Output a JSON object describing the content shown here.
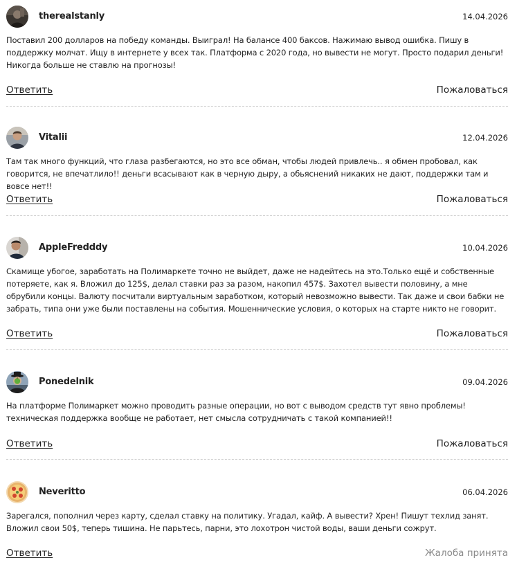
{
  "comments": [
    {
      "username": "therealstanly",
      "date": "14.04.2026",
      "avatar_icon": "avatar-dark-portrait-icon",
      "text": "Поставил 200 долларов на победу команды. Выиграл! На балансе 400 баксов. Нажимаю вывод ошибка. Пишу в поддержку молчат. Ищу в интернете у всех так. Платформа с 2020 года, но вывести не могут. Просто подарил деньги! Никогда больше не ставлю на прогнозы!",
      "reply_label": "Ответить",
      "report_label": "Пожаловаться"
    },
    {
      "username": "Vitalii",
      "date": "12.04.2026",
      "avatar_icon": "avatar-man-portrait-icon",
      "text": "Там так много функций, что глаза разбегаются, но это все обман, чтобы людей привлечь.. я обмен пробовал, как говорится, не впечатлило!! деньги всасывают как в черную дыру, а обьяснений никаких не дают, поддержки там и вовсе нет!!",
      "reply_label": "Ответить",
      "report_label": "Пожаловаться"
    },
    {
      "username": "AppleFredddy",
      "date": "10.04.2026",
      "avatar_icon": "avatar-man-portrait-icon",
      "text": "Скамище убогое, заработать на Полимаркете точно не выйдет, даже не надейтесь на это.Только ещё и собственные потеряете, как я. Вложил до 125$, делал ставки раз за разом, накопил 457$. Захотел вывести половину, а мне обрубили концы. Валюту посчитали виртуальным заработком, который невозможно вывести. Так даже и свои бабки не забрать, типа они уже были поставлены на события. Мошеннические условия, о которых на старте никто не говорит.",
      "reply_label": "Ответить",
      "report_label": "Пожаловаться"
    },
    {
      "username": "Ponedelnik",
      "date": "09.04.2026",
      "avatar_icon": "avatar-man-with-apple-icon",
      "text": "На платформе Полимаркет можно проводить разные операции, но вот с выводом средств тут явно проблемы! техническая поддержка вообще не работает, нет смысла сотрудничать с такой компанией!!",
      "reply_label": "Ответить",
      "report_label": "Пожаловаться"
    },
    {
      "username": "Neveritto",
      "date": "06.04.2026",
      "avatar_icon": "avatar-pizza-icon",
      "text": "Зарегался, пополнил через карту, сделал ставку на политику. Угадал, кайф. А вывести? Хрен! Пишут техлид занят. Вложил свои 50$, теперь тишина. Не парьтесь, парни, это лохотрон чистой воды, ваши деньги сожрут.",
      "reply_label": "Ответить",
      "report_status": "Жалоба принята"
    }
  ]
}
